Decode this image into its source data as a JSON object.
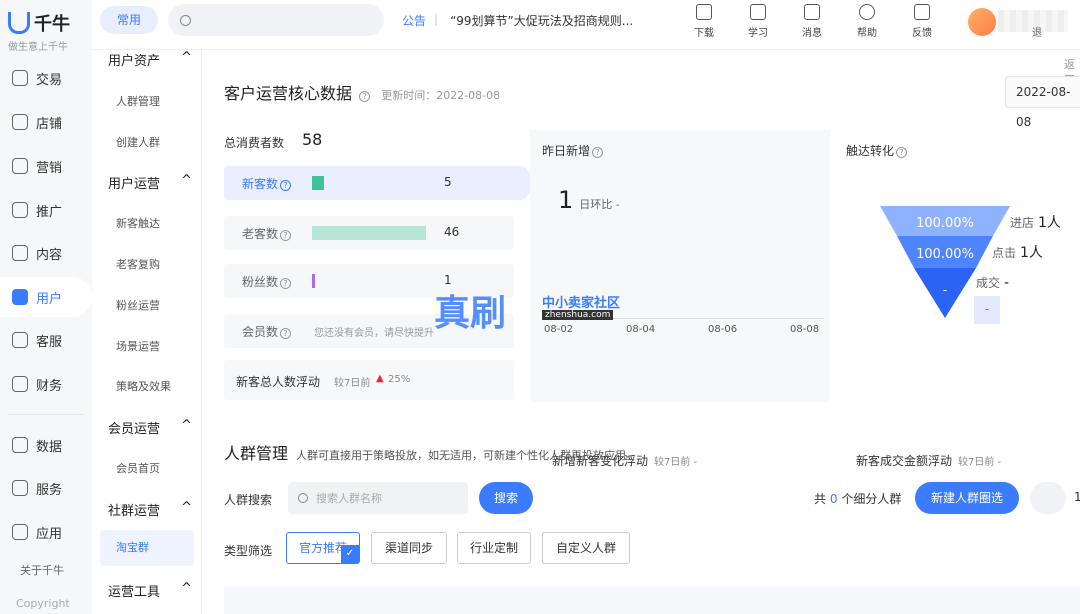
{
  "brand": {
    "name": "千牛",
    "slogan": "做生意上千牛"
  },
  "rail": {
    "items": [
      {
        "label": "交易",
        "icon": "order-icon"
      },
      {
        "label": "店铺",
        "icon": "shop-icon"
      },
      {
        "label": "营销",
        "icon": "marketing-icon"
      },
      {
        "label": "推广",
        "icon": "promotion-icon"
      },
      {
        "label": "内容",
        "icon": "content-icon"
      },
      {
        "label": "用户",
        "icon": "user-icon"
      },
      {
        "label": "客服",
        "icon": "support-icon"
      },
      {
        "label": "财务",
        "icon": "finance-icon"
      },
      {
        "label": "数据",
        "icon": "data-icon"
      },
      {
        "label": "服务",
        "icon": "service-icon"
      },
      {
        "label": "应用",
        "icon": "app-icon"
      }
    ],
    "about": "关于千牛",
    "copyright": "Copyright"
  },
  "subnav": {
    "groups": [
      {
        "title": "用户资产",
        "items": [
          "人群管理",
          "创建人群"
        ]
      },
      {
        "title": "用户运营",
        "items": [
          "新客触达",
          "老客复购",
          "粉丝运营",
          "场景运营",
          "策略及效果"
        ]
      },
      {
        "title": "会员运营",
        "items": [
          "会员首页"
        ]
      },
      {
        "title": "社群运营",
        "items": [
          "淘宝群"
        ]
      },
      {
        "title": "运营工具",
        "items": []
      }
    ],
    "caret": "^"
  },
  "header": {
    "common_label": "常用",
    "notice_tag": "公告",
    "notice_text": "“99划算节”大促玩法及招商规则...",
    "tools": [
      "下载",
      "学习",
      "消息",
      "帮助",
      "反馈"
    ],
    "user_suffix": "退"
  },
  "core": {
    "title": "客户运营核心数据",
    "update_label": "更新时间：2022-08-08",
    "date": "2022-08-08",
    "back": "返回",
    "total_label": "总消费者数",
    "total_value": "58",
    "rows": [
      {
        "label": "新客数",
        "value": "5",
        "color": "#3fc19a",
        "share": 0.109
      },
      {
        "label": "老客数",
        "value": "46",
        "color": "#b7e6d7",
        "share": 1.0
      },
      {
        "label": "粉丝数",
        "value": "1",
        "color": "#a66cf0",
        "share": 0.022
      },
      {
        "label": "会员数",
        "value": "您还没有会员，请尽快提升"
      }
    ],
    "footer_label": "新客总人数浮动",
    "footer_compare": "较7日前",
    "footer_arrow": "▲",
    "footer_change": "25%"
  },
  "yesterday": {
    "title": "昨日新增",
    "value": "1",
    "ratio": "日环比 -",
    "ticks": [
      "08-02",
      "08-04",
      "08-06",
      "08-08"
    ],
    "footer_label": "新增新客变化浮动",
    "footer_compare": "较7日前 -"
  },
  "conversion": {
    "title": "触达转化",
    "tiers": [
      "100.00%",
      "100.00%",
      "-"
    ],
    "steps": [
      {
        "label": "进店",
        "value": "1人"
      },
      {
        "label": "点击",
        "value": "1人"
      },
      {
        "label": "成交",
        "value": "-"
      }
    ],
    "small_box": "-",
    "footer_label": "新客成交金额浮动",
    "footer_compare": "较7日前 -"
  },
  "crowd": {
    "title": "人群管理",
    "desc": "人群可直接用于策略投放，如无适用，可新建个性化人群再投放应用。",
    "search_label": "人群搜索",
    "search_placeholder": "搜索人群名称",
    "search_button": "搜索",
    "count_prefix": "共",
    "count_value": "0",
    "count_suffix": "个细分人群",
    "new_button": "新建人群圈选",
    "page_num": "1",
    "filter_label": "类型筛选",
    "filters": [
      "官方推荐",
      "渠道同步",
      "行业定制",
      "自定义人群"
    ]
  },
  "watermark": {
    "main": "真刷",
    "side": "中小卖家社区",
    "url": "zhenshua.com"
  }
}
